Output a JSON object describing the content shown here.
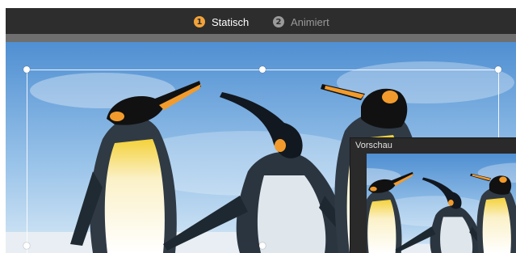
{
  "steps": [
    {
      "number": "1",
      "label": "Statisch",
      "active": true
    },
    {
      "number": "2",
      "label": "Animiert",
      "active": false
    }
  ],
  "preview": {
    "title": "Vorschau"
  },
  "image": {
    "subject": "penguins-photo"
  },
  "colors": {
    "accent": "#f2a33a",
    "inactive": "#9a9a9a",
    "toolbar": "#2d2d2d",
    "sky": "#6fa6d8"
  }
}
